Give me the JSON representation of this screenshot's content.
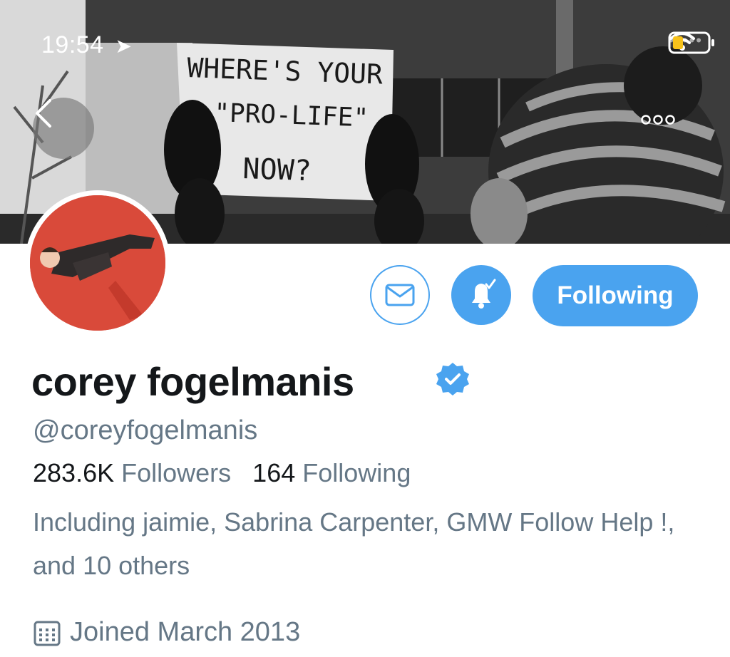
{
  "status_bar": {
    "time": "19:54"
  },
  "banner": {
    "sign_line1": "WHERE'S YOUR",
    "sign_line2": "\"PRO-LIFE\"",
    "sign_line3": "NOW?"
  },
  "profile": {
    "name": "corey fogelmanis",
    "handle": "@coreyfogelmanis",
    "followers_count": "283.6K",
    "followers_label": "Followers",
    "following_count": "164",
    "following_label": "Following",
    "followed_by": "Including jaimie, Sabrina Carpenter, GMW Follow Help !, and 10 others",
    "joined": "Joined March 2013"
  },
  "actions": {
    "follow_state_label": "Following"
  },
  "colors": {
    "accent": "#4aa3ef",
    "text_primary": "#14171a",
    "text_secondary": "#657786"
  }
}
